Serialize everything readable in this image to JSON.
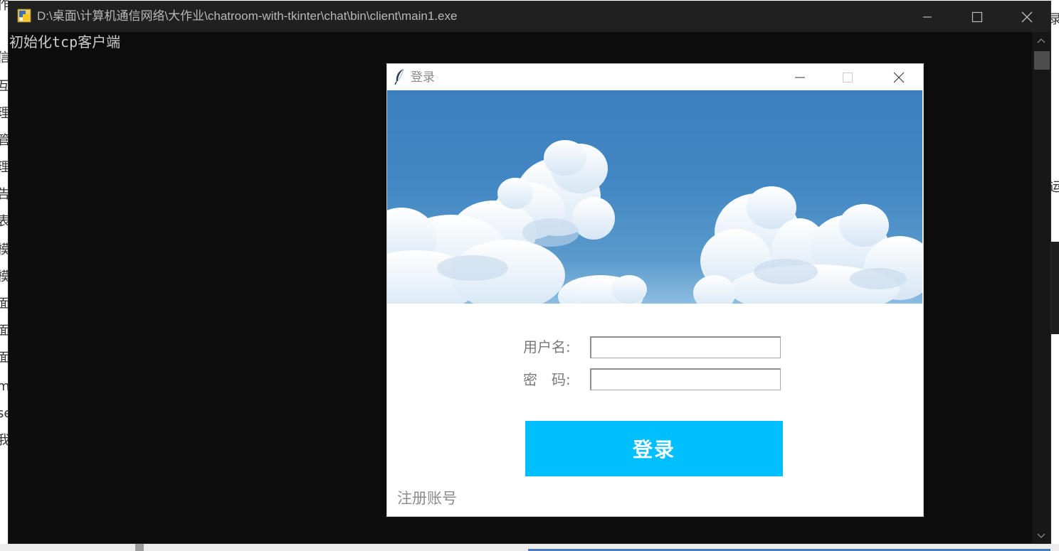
{
  "background_window": {
    "left_clipped_chars": [
      "作",
      "信",
      "互",
      "理",
      "管",
      "理",
      "告",
      "表",
      "模",
      "模",
      "面",
      "面",
      "面",
      "m",
      "se",
      "我"
    ],
    "right_clipped_chars": [
      "录",
      "运"
    ]
  },
  "console": {
    "title": "D:\\桌面\\计算机通信网络\\大作业\\chatroom-with-tkinter\\chat\\bin\\client\\main1.exe",
    "output_line": "初始化tcp客户端",
    "controls": [
      "minimize-icon",
      "maximize-icon",
      "close-icon"
    ]
  },
  "login_dialog": {
    "title": "登录",
    "icon": "feather-icon",
    "banner": "sky-clouds-image",
    "username_label": "用户名:",
    "username_value": "",
    "password_label": "密　码:",
    "password_value": "",
    "login_button": "登录",
    "register_link": "注册账号",
    "colors": {
      "login_button_bg": "#00bfff",
      "login_button_text": "#ffffff",
      "label_text": "#7a7a7a"
    }
  }
}
